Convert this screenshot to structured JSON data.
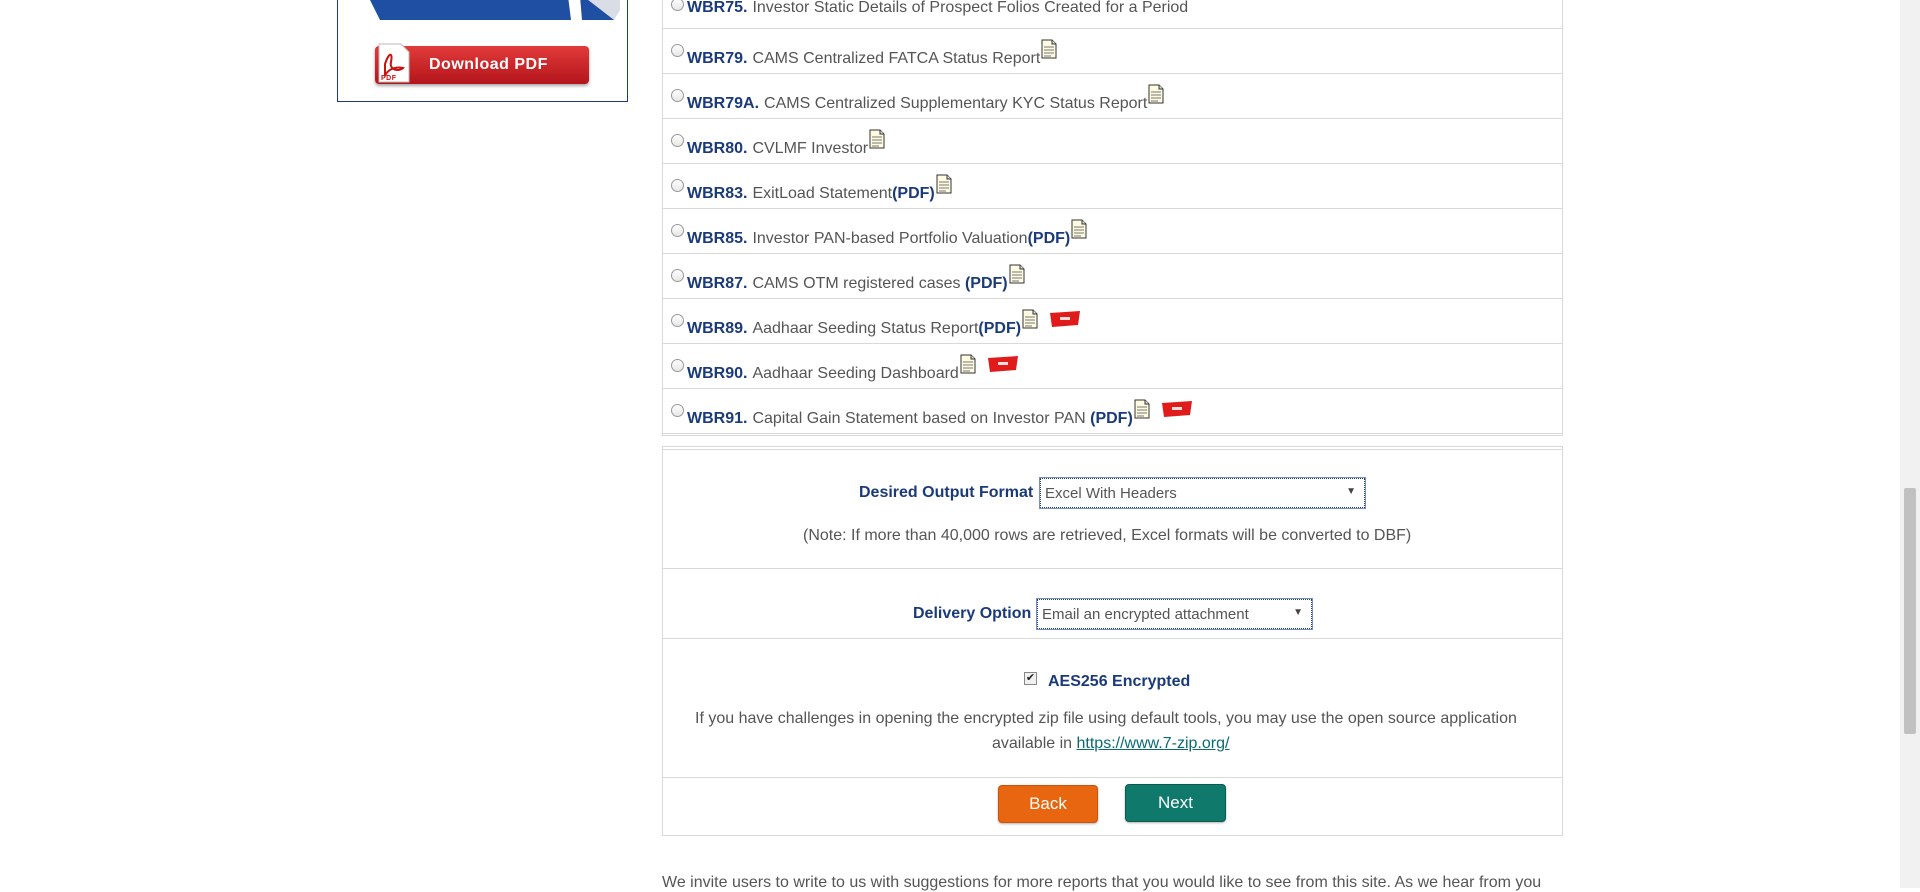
{
  "sidebar": {
    "download_label": "Download PDF",
    "pdf_badge": "PDF"
  },
  "reports": [
    {
      "code": "WBR75.",
      "name": "Investor Static Details of Prospect Folios Created for a Period",
      "pdf": "",
      "doc": false,
      "new": false
    },
    {
      "code": "WBR79.",
      "name": "CAMS Centralized FATCA Status Report",
      "pdf": "",
      "doc": true,
      "new": false
    },
    {
      "code": "WBR79A.",
      "name": "CAMS Centralized Supplementary KYC Status Report",
      "pdf": "",
      "doc": true,
      "new": false
    },
    {
      "code": "WBR80.",
      "name": "CVLMF Investor",
      "pdf": "",
      "doc": true,
      "new": false
    },
    {
      "code": "WBR83.",
      "name": "ExitLoad Statement",
      "pdf": "(PDF)",
      "doc": true,
      "new": false
    },
    {
      "code": "WBR85.",
      "name": "Investor PAN-based Portfolio Valuation",
      "pdf": "(PDF)",
      "doc": true,
      "new": false
    },
    {
      "code": "WBR87.",
      "name": "CAMS OTM registered cases ",
      "pdf": "(PDF)",
      "doc": true,
      "new": false
    },
    {
      "code": "WBR89.",
      "name": "Aadhaar Seeding Status Report",
      "pdf": "(PDF)",
      "doc": true,
      "new": true
    },
    {
      "code": "WBR90.",
      "name": "Aadhaar Seeding Dashboard",
      "pdf": "",
      "doc": true,
      "new": true
    },
    {
      "code": "WBR91.",
      "name": "Capital Gain Statement based on Investor PAN ",
      "pdf": "(PDF)",
      "doc": true,
      "new": true
    }
  ],
  "output_format": {
    "label": "Desired Output Format",
    "selected": "Excel With Headers",
    "note": "(Note: If more than 40,000 rows are retrieved, Excel formats will be converted to DBF)"
  },
  "delivery": {
    "label": "Delivery Option",
    "selected": "Email an encrypted attachment"
  },
  "encryption": {
    "checkbox_label": "AES256 Encrypted",
    "checked": true,
    "help_line1": "If you have challenges in opening the encrypted zip file using default tools, you may use the open source application",
    "help_line2_prefix": "available in ",
    "link_text": "https://www.7-zip.org/"
  },
  "actions": {
    "back_label": "Back",
    "next_label": "Next"
  },
  "footer": {
    "text": "We invite users to write to us with suggestions for more reports that you would like to see from this site. As we hear from you"
  },
  "colors": {
    "brand_blue": "#1b3a7a",
    "back_orange": "#e8660f",
    "next_teal": "#0f7a6c",
    "new_badge_red": "#e01b1b"
  }
}
